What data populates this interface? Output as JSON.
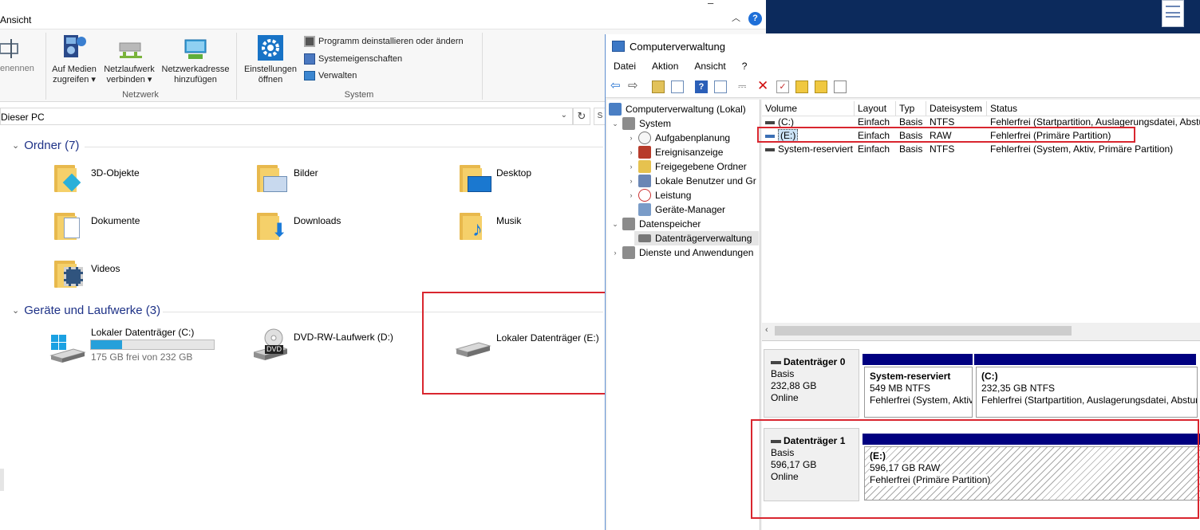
{
  "explorer": {
    "menu_ansicht": "Ansicht",
    "ribbon": {
      "rename_partial": "enennen",
      "media_l1": "Auf Medien",
      "media_l2": "zugreifen",
      "netdrive_l1": "Netzlaufwerk",
      "netdrive_l2": "verbinden",
      "netaddr_l1": "Netzwerkadresse",
      "netaddr_l2": "hinzufügen",
      "group_netzwerk": "Netzwerk",
      "settings_l1": "Einstellungen",
      "settings_l2": "öffnen",
      "uninstall": "Programm deinstallieren oder ändern",
      "sysprops": "Systemeigenschaften",
      "manage": "Verwalten",
      "group_system": "System"
    },
    "address": "Dieser PC",
    "ordner_header": "Ordner (7)",
    "folders": [
      {
        "name": "3D-Objekte"
      },
      {
        "name": "Bilder"
      },
      {
        "name": "Desktop"
      },
      {
        "name": "Dokumente"
      },
      {
        "name": "Downloads"
      },
      {
        "name": "Musik"
      },
      {
        "name": "Videos"
      }
    ],
    "devices_header": "Geräte und Laufwerke (3)",
    "drives": [
      {
        "name": "Lokaler Datenträger (C:)",
        "free": "175 GB frei von 232 GB",
        "used_fraction": 0.25
      },
      {
        "name": "DVD-RW-Laufwerk (D:)"
      },
      {
        "name": "Lokaler Datenträger (E:)"
      }
    ],
    "dvd_badge": "DVD",
    "help": "?"
  },
  "cv": {
    "title": "Computerverwaltung",
    "menu": [
      "Datei",
      "Aktion",
      "Ansicht",
      "?"
    ],
    "tree": [
      {
        "label": "Computerverwaltung (Lokal)"
      },
      {
        "label": "System"
      },
      {
        "label": "Aufgabenplanung"
      },
      {
        "label": "Ereignisanzeige"
      },
      {
        "label": "Freigegebene Ordner"
      },
      {
        "label": "Lokale Benutzer und Gr"
      },
      {
        "label": "Leistung"
      },
      {
        "label": "Geräte-Manager"
      },
      {
        "label": "Datenspeicher"
      },
      {
        "label": "Datenträgerverwaltung"
      },
      {
        "label": "Dienste und Anwendungen"
      }
    ],
    "columns": [
      "Volume",
      "Layout",
      "Typ",
      "Dateisystem",
      "Status"
    ],
    "volumes": [
      {
        "volume": "(C:)",
        "layout": "Einfach",
        "typ": "Basis",
        "fs": "NTFS",
        "status": "Fehlerfrei (Startpartition, Auslagerungsdatei, Absturz"
      },
      {
        "volume": "(E:)",
        "layout": "Einfach",
        "typ": "Basis",
        "fs": "RAW",
        "status": "Fehlerfrei (Primäre Partition)"
      },
      {
        "volume": "System-reserviert",
        "layout": "Einfach",
        "typ": "Basis",
        "fs": "NTFS",
        "status": "Fehlerfrei (System, Aktiv, Primäre Partition)"
      }
    ],
    "disk0": {
      "name": "Datenträger 0",
      "type": "Basis",
      "size": "232,88 GB",
      "state": "Online",
      "p1": {
        "name": "System-reserviert",
        "size": "549 MB NTFS",
        "status": "Fehlerfrei (System, Aktiv"
      },
      "p2": {
        "name": "(C:)",
        "size": "232,35 GB NTFS",
        "status": "Fehlerfrei (Startpartition, Auslagerungsdatei, Absturz"
      }
    },
    "disk1": {
      "name": "Datenträger 1",
      "type": "Basis",
      "size": "596,17 GB",
      "state": "Online",
      "p1": {
        "name": "(E:)",
        "size": "596,17 GB RAW",
        "status": "Fehlerfrei (Primäre Partition)"
      }
    }
  },
  "colors": {
    "highlight_red": "#d9262f",
    "partition_blue": "#000080",
    "section_blue": "#1e3287",
    "drive_fill": "#26a0da"
  }
}
